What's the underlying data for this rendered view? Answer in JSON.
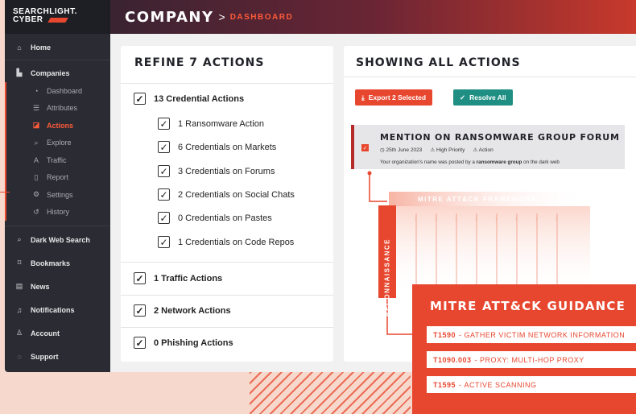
{
  "brand": {
    "line1": "SEARCHLIGHT.",
    "line2": "CYBER"
  },
  "header": {
    "title": "COMPANY",
    "separator": ">",
    "subtitle": "DASHBOARD"
  },
  "sidebar": {
    "home": {
      "label": "Home",
      "icon": "home-icon"
    },
    "companies": {
      "label": "Companies",
      "icon": "building-icon"
    },
    "sub_items": [
      {
        "label": "Dashboard",
        "icon": "dashboard-icon"
      },
      {
        "label": "Attributes",
        "icon": "list-icon"
      },
      {
        "label": "Actions",
        "icon": "actions-icon"
      },
      {
        "label": "Explore",
        "icon": "search-icon"
      },
      {
        "label": "Traffic",
        "icon": "traffic-icon"
      },
      {
        "label": "Report",
        "icon": "report-icon"
      },
      {
        "label": "Settings",
        "icon": "gear-icon"
      },
      {
        "label": "History",
        "icon": "history-icon"
      }
    ],
    "bottom_items": [
      {
        "label": "Dark Web Search",
        "icon": "search-icon"
      },
      {
        "label": "Bookmarks",
        "icon": "bookmark-icon"
      },
      {
        "label": "News",
        "icon": "news-icon"
      },
      {
        "label": "Notifications",
        "icon": "bell-icon"
      },
      {
        "label": "Account",
        "icon": "user-icon"
      },
      {
        "label": "Support",
        "icon": "chat-icon"
      }
    ]
  },
  "refine": {
    "title": "REFINE 7 ACTIONS",
    "credential": {
      "label": "13 Credential Actions",
      "checked": true
    },
    "credential_items": [
      "1 Ransomware Action",
      "6 Credentials on Markets",
      "3 Credentials on Forums",
      "2 Credentials on Social Chats",
      "0 Credentials on Pastes",
      "1 Credentials on Code Repos"
    ],
    "traffic": "1 Traffic Actions",
    "network": "2 Network Actions",
    "phishing": "0 Phishing Actions"
  },
  "showing": {
    "title": "SHOWING ALL ACTIONS",
    "export_label": "Export 2 Selected",
    "resolve_label": "Resolve All",
    "colors": {
      "export": "#e8472f",
      "resolve": "#1f8f84",
      "accent": "#e8472f"
    }
  },
  "mention": {
    "title": "MENTION ON RANSOMWARE GROUP FORUM",
    "date": "25th June 2023",
    "priority": "High Priority",
    "type": "Action",
    "desc_prefix": "Your organization's name was posted by a ",
    "desc_bold": "ransomware group",
    "desc_suffix": " on the dark web"
  },
  "mitre": {
    "framework": "MITRE ATT&CK FRAMEWORK",
    "tactic": "RECONNAISSANCE"
  },
  "guidance": {
    "title": "MITRE ATT&CK GUIDANCE",
    "items": [
      {
        "id": "T1590",
        "desc": "GATHER VICTIM NETWORK INFORMATION"
      },
      {
        "id": "T1090.003",
        "desc": "PROXY: MULTI-HOP PROXY"
      },
      {
        "id": "T1595",
        "desc": "ACTIVE SCANNING"
      }
    ]
  }
}
